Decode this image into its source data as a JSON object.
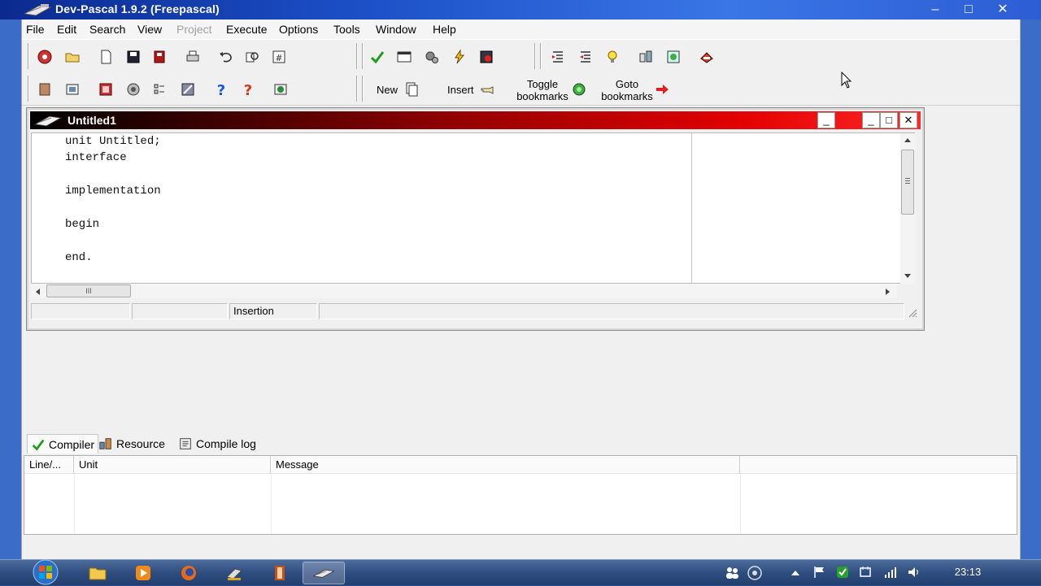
{
  "app": {
    "title": "Dev-Pascal 1.9.2 (Freepascal)",
    "controls": {
      "minimize": "–",
      "maximize": "□",
      "close": "✕"
    }
  },
  "menu": {
    "file": "File",
    "edit": "Edit",
    "search": "Search",
    "view": "View",
    "project": "Project",
    "execute": "Execute",
    "options": "Options",
    "tools": "Tools",
    "window": "Window",
    "help": "Help"
  },
  "toolbar2": {
    "new_label": "New",
    "insert_label": "Insert",
    "toggle_bookmarks": [
      "Toggle",
      "bookmarks"
    ],
    "goto_bookmarks": [
      "Goto",
      "bookmarks"
    ]
  },
  "editor_window": {
    "title": "Untitled1",
    "code_lines": [
      "unit Untitled;",
      "interface",
      "",
      "implementation",
      "",
      "begin",
      "",
      "end."
    ],
    "status": {
      "mode": "Insertion"
    },
    "scroll_grip": "III"
  },
  "bottom_panel": {
    "tabs": {
      "compiler": "Compiler",
      "resource": "Resource",
      "compile_log": "Compile log"
    },
    "columns": {
      "line": "Line/...",
      "unit": "Unit",
      "message": "Message"
    }
  },
  "taskbar": {
    "clock": "23:13"
  },
  "colors": {
    "app_title": "#1c50c8",
    "editor_title_end": "#ff2a2a",
    "check_green": "#1a9e1a"
  }
}
